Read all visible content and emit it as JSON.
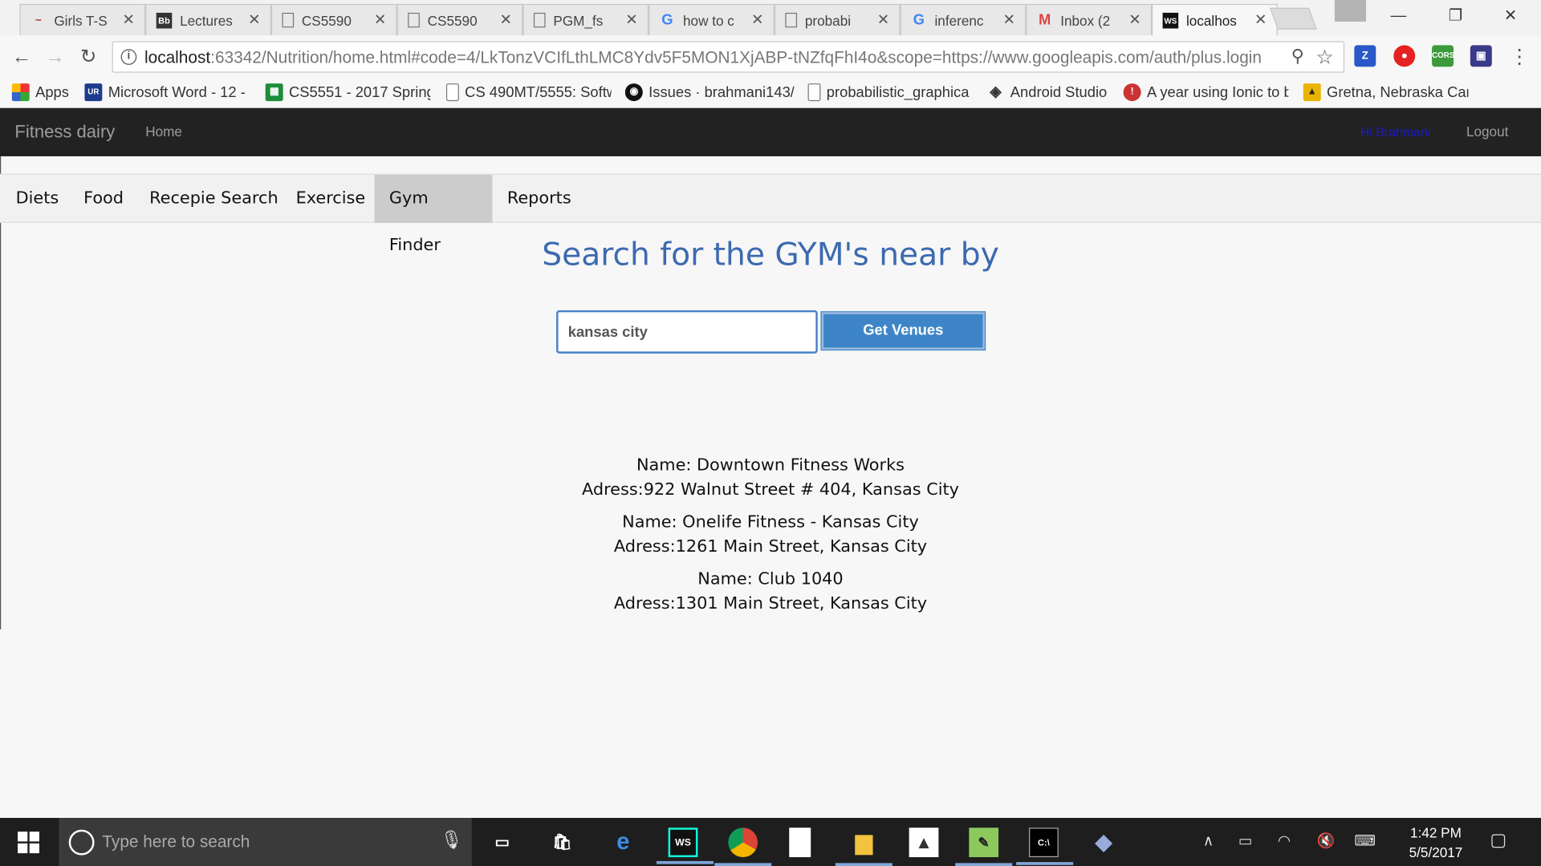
{
  "browser": {
    "tabs": [
      {
        "title": "Girls T-S",
        "icon": "hollister-icon",
        "active": false
      },
      {
        "title": "Lectures",
        "icon": "blackboard-icon",
        "active": false
      },
      {
        "title": "CS5590",
        "icon": "document-icon",
        "active": false
      },
      {
        "title": "CS5590",
        "icon": "document-icon",
        "active": false
      },
      {
        "title": "PGM_fs",
        "icon": "document-icon",
        "active": false
      },
      {
        "title": "how to c",
        "icon": "google-icon",
        "active": false
      },
      {
        "title": "probabi",
        "icon": "document-icon",
        "active": false
      },
      {
        "title": "inferenc",
        "icon": "google-icon",
        "active": false
      },
      {
        "title": "Inbox (2",
        "icon": "gmail-icon",
        "active": false
      },
      {
        "title": "localhos",
        "icon": "webstorm-icon",
        "active": true
      }
    ],
    "url_host": "localhost",
    "url_rest": ":63342/Nutrition/home.html#code=4/LkTonzVCIfLthLMC8Ydv5F5MON1XjABP-tNZfqFhI4o&scope=https://www.googleapis.com/auth/plus.login",
    "bookmarks": [
      {
        "label": "Apps",
        "icon": "apps-grid-icon"
      },
      {
        "label": "Microsoft Word - 12 -",
        "icon": "umkc-icon"
      },
      {
        "label": "CS5551 - 2017 Spring",
        "icon": "sheets-icon"
      },
      {
        "label": "CS 490MT/5555: Softw",
        "icon": "document-icon"
      },
      {
        "label": "Issues · brahmani143/",
        "icon": "github-icon"
      },
      {
        "label": "probabilistic_graphica",
        "icon": "document-icon"
      },
      {
        "label": "Android Studio",
        "icon": "android-studio-icon"
      },
      {
        "label": "A year using Ionic to b",
        "icon": "ionic-icon"
      },
      {
        "label": "Gretna, Nebraska Can",
        "icon": "campground-icon"
      }
    ]
  },
  "app": {
    "brand": "Fitness dairy",
    "home": "Home",
    "greeting": "Hi Brahmani",
    "logout": "Logout",
    "tabs": [
      "Diets",
      "Food",
      "Recepie Search",
      "Exercise",
      "Gym Finder",
      "Reports"
    ],
    "active_tab": "Gym Finder",
    "heading": "Search for the GYM's near by",
    "search_value": "kansas city",
    "button_label": "Get Venues",
    "venues": [
      {
        "name": "Name: Downtown Fitness Works",
        "address": "Adress:922 Walnut Street # 404, Kansas City"
      },
      {
        "name": "Name: Onelife Fitness - Kansas City",
        "address": "Adress:1261 Main Street, Kansas City"
      },
      {
        "name": "Name: Club 1040",
        "address": "Adress:1301 Main Street, Kansas City"
      }
    ]
  },
  "taskbar": {
    "search_placeholder": "Type here to search",
    "time": "1:42 PM",
    "date": "5/5/2017"
  },
  "colors": {
    "accent": "#3d85c6",
    "heading": "#3c6ab0",
    "navbar": "#222222",
    "active_tab": "#cccccc"
  }
}
